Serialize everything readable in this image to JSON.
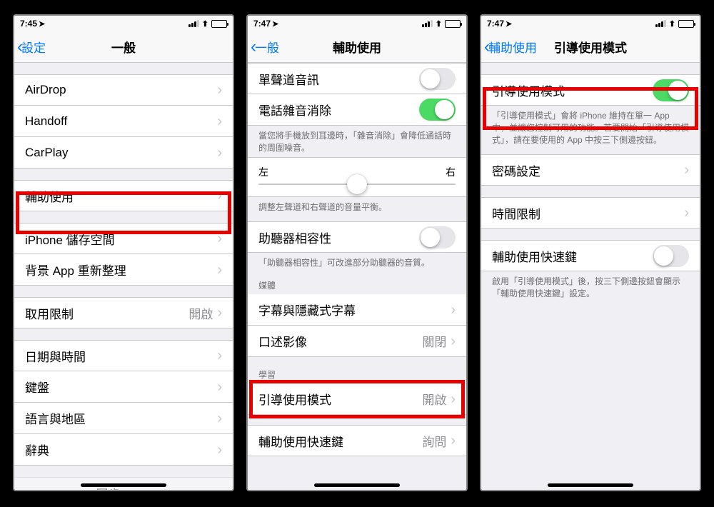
{
  "status": {
    "time1": "7:45",
    "time2": "7:47",
    "time3": "7:47",
    "loc": "➤"
  },
  "screen1": {
    "back": "設定",
    "title": "一般",
    "rows_g1": [
      {
        "label": "AirDrop"
      },
      {
        "label": "Handoff"
      },
      {
        "label": "CarPlay"
      }
    ],
    "rows_g2": [
      {
        "label": "輔助使用"
      }
    ],
    "rows_g3": [
      {
        "label": "iPhone 儲存空間"
      },
      {
        "label": "背景 App 重新整理"
      }
    ],
    "rows_g4": [
      {
        "label": "取用限制",
        "value": "開啟"
      }
    ],
    "rows_g5": [
      {
        "label": "日期與時間"
      },
      {
        "label": "鍵盤"
      },
      {
        "label": "語言與地區"
      },
      {
        "label": "辭典"
      }
    ],
    "cutoff_label": "iTunes Wi-Fi 同步"
  },
  "screen2": {
    "back": "一般",
    "title": "輔助使用",
    "mono_label": "單聲道音訊",
    "noise_label": "電話雜音消除",
    "noise_footer": "當您將手機放到耳邊時，「雜音消除」會降低通話時的周圍噪音。",
    "balance_left": "左",
    "balance_right": "右",
    "balance_footer": "調整左聲道和右聲道的音量平衡。",
    "hearing_label": "助聽器相容性",
    "hearing_footer": "「助聽器相容性」可改進部分助聽器的音質。",
    "media_header": "媒體",
    "captions_label": "字幕與隱藏式字幕",
    "audio_desc_label": "口述影像",
    "audio_desc_value": "關閉",
    "learning_header": "學習",
    "guided_label": "引導使用模式",
    "guided_value": "開啟",
    "shortcut_label": "輔助使用快速鍵",
    "shortcut_value": "詢問"
  },
  "screen3": {
    "back": "輔助使用",
    "title": "引導使用模式",
    "main_label": "引導使用模式",
    "main_footer": "「引導使用模式」會將 iPhone 維持在單一 App 中，並讓您控制可用的功能。若要開始「引導使用模式」，請在要使用的 App 中按三下側邊按鈕。",
    "passcode_label": "密碼設定",
    "time_label": "時間限制",
    "shortcut_label": "輔助使用快速鍵",
    "shortcut_footer": "啟用「引導使用模式」後，按三下側邊按鈕會顯示「輔助使用快速鍵」設定。"
  }
}
